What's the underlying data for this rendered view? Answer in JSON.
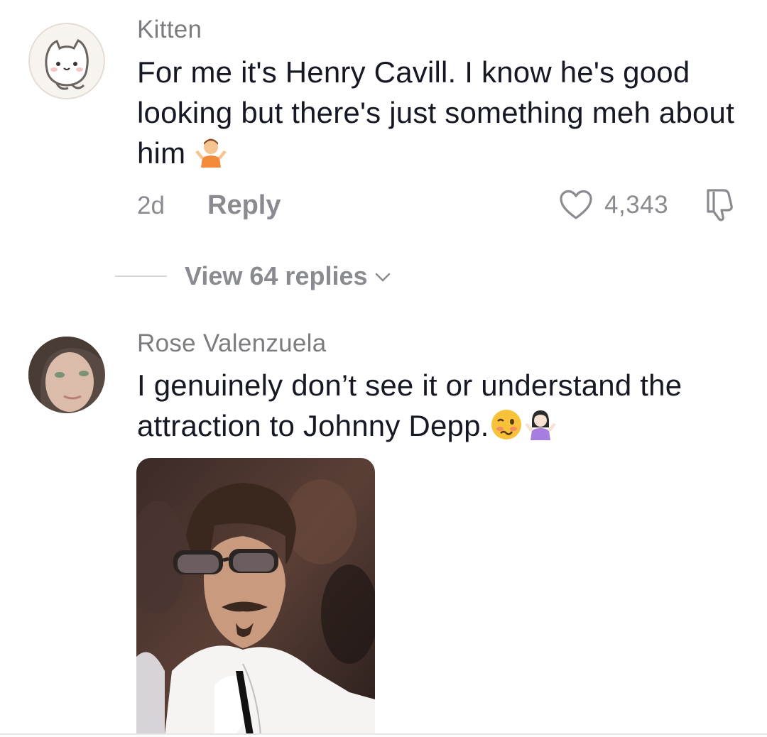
{
  "comments": [
    {
      "username": "Kitten",
      "text": "For me it's Henry Cavill. I know he's good looking but there's just something meh about him",
      "emojis": [
        "person-shrugging-emoji"
      ],
      "time": "2d",
      "reply_label": "Reply",
      "like_count": "4,343",
      "view_replies_label": "View 64 replies"
    },
    {
      "username": "Rose Valenzuela",
      "text": "I genuinely don’t see it or understand the attraction to Johnny Depp.",
      "emojis": [
        "woozy-face-emoji",
        "woman-shrugging-emoji"
      ],
      "attachment": "photo-man-in-sunglasses"
    }
  ],
  "colors": {
    "primary_text": "#161823",
    "secondary_text": "#8a8b91",
    "username_text": "#7c7c80"
  }
}
